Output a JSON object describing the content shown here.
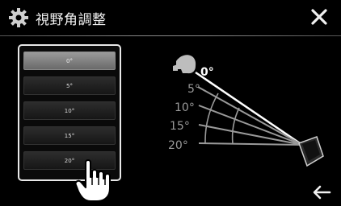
{
  "header": {
    "title": "視野角調整",
    "close_icon": "close-icon",
    "settings_icon": "gear-icon"
  },
  "angle_options": [
    {
      "label": "0°",
      "selected": true
    },
    {
      "label": "5°",
      "selected": false
    },
    {
      "label": "10°",
      "selected": false
    },
    {
      "label": "15°",
      "selected": false
    },
    {
      "label": "20°",
      "selected": false
    }
  ],
  "diagram": {
    "labels": [
      "0°",
      "5°",
      "10°",
      "15°",
      "20°"
    ],
    "highlight_color": "#ffffff",
    "dim_color": "#9a9a9a"
  },
  "footer": {
    "back_icon": "back-arrow-icon"
  }
}
